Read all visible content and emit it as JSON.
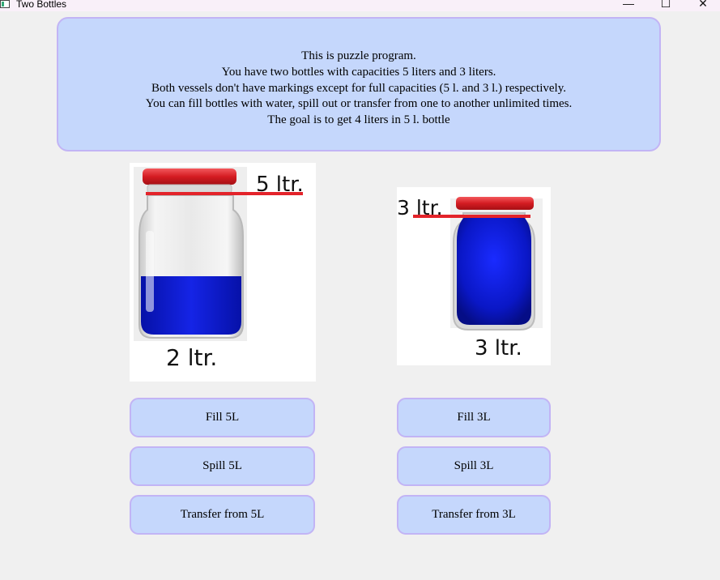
{
  "window": {
    "title": "Two Bottles",
    "controls": {
      "minimize": "—",
      "maximize": "☐",
      "close": "✕"
    }
  },
  "info": {
    "lines": [
      "This is puzzle program.",
      "You have two bottles with capacities 5 liters and 3 liters.",
      "Both vessels don't have markings except for full capacities (5 l. and 3 l.) respectively.",
      "You can fill bottles with water, spill out or transfer from one to another unlimited times.",
      "The goal is to get 4 liters in 5 l. bottle"
    ]
  },
  "bottles": {
    "big": {
      "capacity_label": "5 ltr.",
      "level_label": "2 ltr.",
      "level": 2,
      "capacity": 5
    },
    "small": {
      "capacity_label": "3 ltr.",
      "level_label": "3 ltr.",
      "level": 3,
      "capacity": 3
    }
  },
  "buttons": {
    "fill5": "Fill 5L",
    "spill5": "Spill 5L",
    "transfer5": "Transfer from 5L",
    "fill3": "Fill 3L",
    "spill3": "Spill 3L",
    "transfer3": "Transfer from 3L"
  },
  "colors": {
    "water": "#0f1ccc",
    "lid": "#e3232a",
    "panel": "#c5d7fc",
    "panel_border": "#c2b4f5"
  }
}
